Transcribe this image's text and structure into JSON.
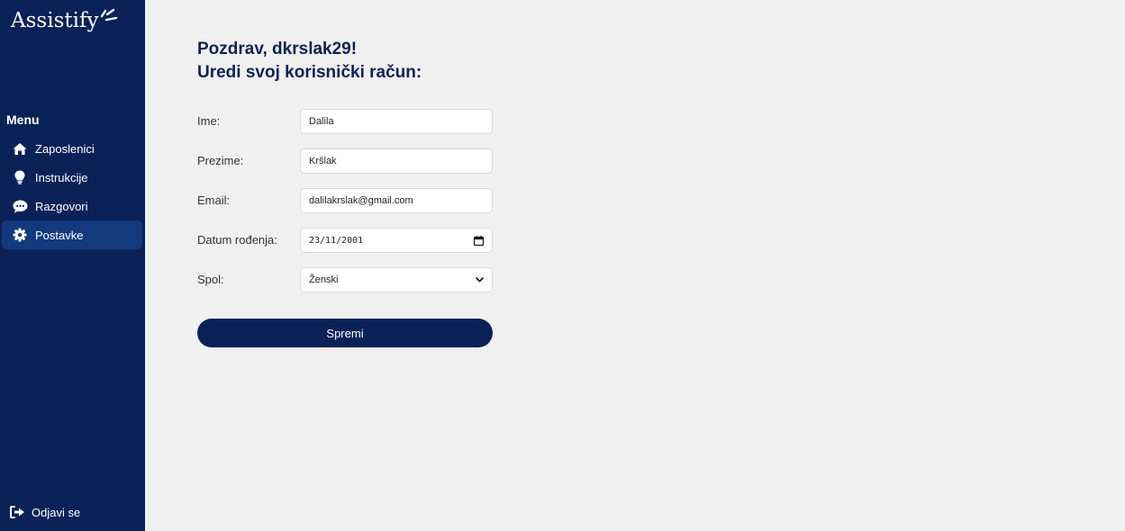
{
  "app": {
    "logo_text": "Assistify"
  },
  "sidebar": {
    "menu_title": "Menu",
    "items": [
      {
        "label": "Zaposlenici",
        "icon": "home-icon",
        "active": false
      },
      {
        "label": "Instrukcije",
        "icon": "lightbulb-icon",
        "active": false
      },
      {
        "label": "Razgovori",
        "icon": "chat-icon",
        "active": false
      },
      {
        "label": "Postavke",
        "icon": "gear-icon",
        "active": true
      }
    ],
    "logout_label": "Odjavi se"
  },
  "main": {
    "greeting_line1": "Pozdrav, dkrslak29!",
    "greeting_line2": "Uredi svoj korisnički račun:"
  },
  "form": {
    "first_name": {
      "label": "Ime:",
      "value": "Dalila"
    },
    "last_name": {
      "label": "Prezime:",
      "value": "Kršlak"
    },
    "email": {
      "label": "Email:",
      "value": "dalilakrslak@gmail.com"
    },
    "birth_date": {
      "label": "Datum rođenja:",
      "value": "23/11/2001"
    },
    "gender": {
      "label": "Spol:",
      "value": "Ženski"
    },
    "save_label": "Spremi"
  },
  "colors": {
    "sidebar_bg": "#0b2259",
    "active_item_bg": "#133a7d",
    "page_bg": "#f0f0f0",
    "accent": "#0b2259"
  }
}
